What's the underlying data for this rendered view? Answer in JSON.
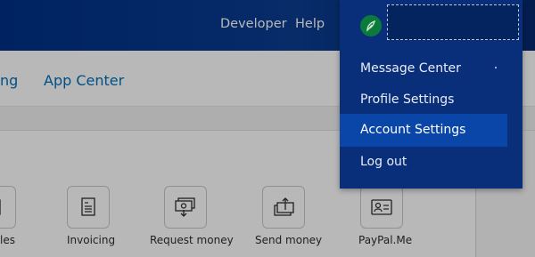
{
  "header": {
    "links": [
      "Developer",
      "Help"
    ]
  },
  "subnav": {
    "partial_item": "ng",
    "app_center": "App Center"
  },
  "tiles": [
    {
      "label": "les",
      "icon": "document-icon"
    },
    {
      "label": "Invoicing",
      "icon": "invoice-icon"
    },
    {
      "label": "Request money",
      "icon": "request-money-icon"
    },
    {
      "label": "Send money",
      "icon": "send-money-icon"
    },
    {
      "label": "PayPal.Me",
      "icon": "id-card-icon"
    }
  ],
  "account_menu": {
    "items": [
      "Message Center",
      "Profile Settings",
      "Account Settings",
      "Log out"
    ],
    "active": "Account Settings"
  },
  "colors": {
    "header": "#0a3d91",
    "link": "#0070ba",
    "menu_bg": "#0a2f7a",
    "menu_active": "#0a46a8"
  }
}
